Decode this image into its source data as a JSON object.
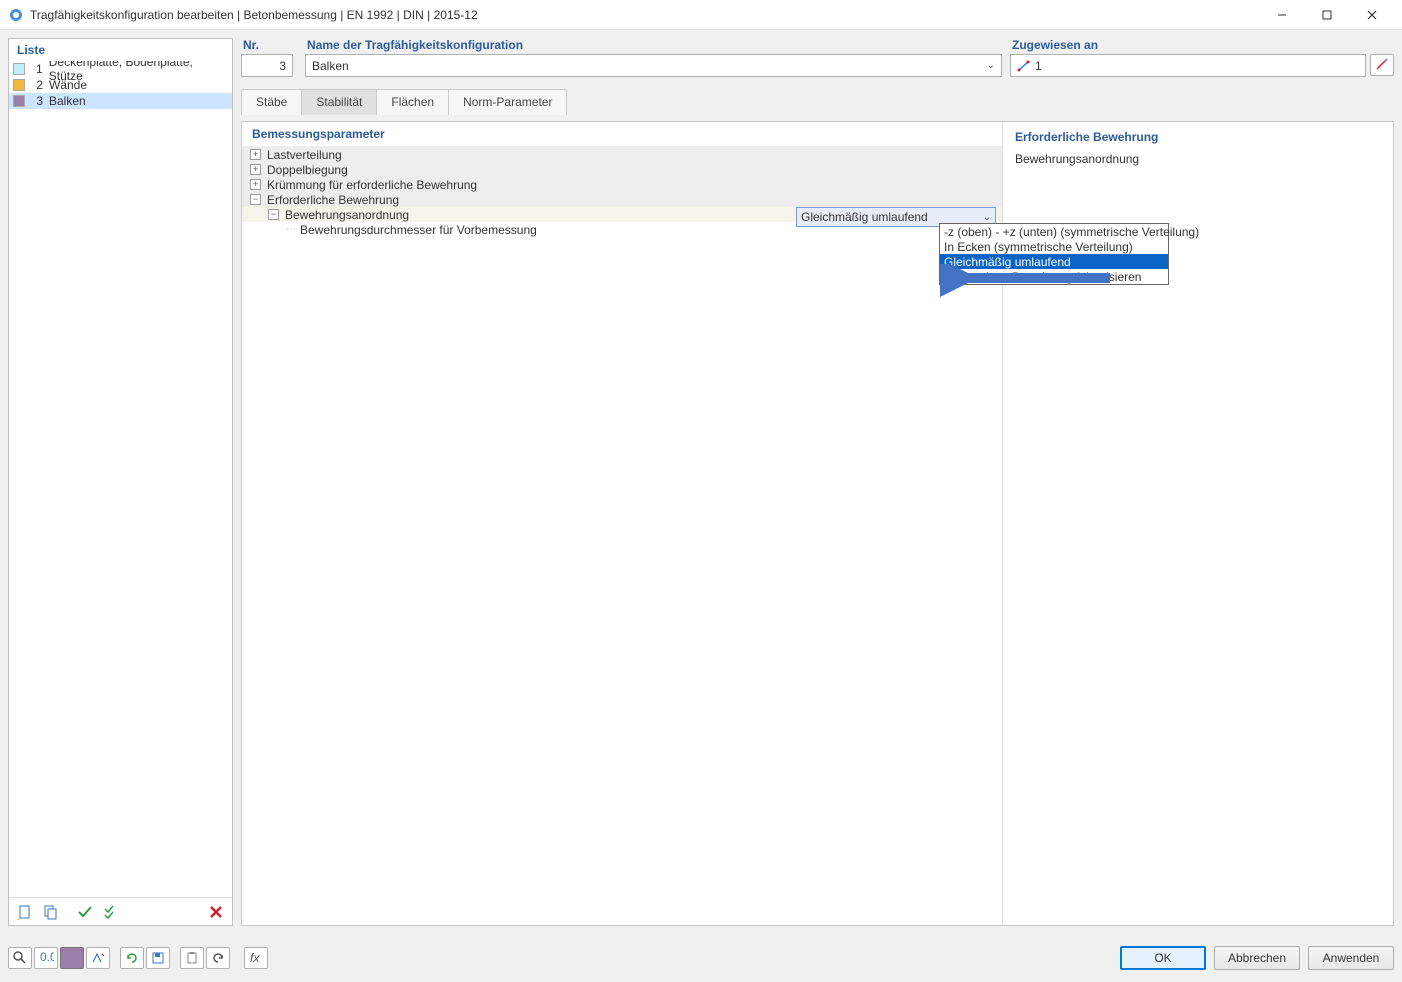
{
  "titlebar": {
    "title": "Tragfähigkeitskonfiguration bearbeiten | Betonbemessung | EN 1992 | DIN | 2015-12"
  },
  "leftPanel": {
    "header": "Liste",
    "items": [
      {
        "num": "1",
        "label": "Deckenplatte, Bodenplatte, Stütze",
        "color": "#bfeff2"
      },
      {
        "num": "2",
        "label": "Wände",
        "color": "#f2b63c"
      },
      {
        "num": "3",
        "label": "Balken",
        "color": "#9a7fa8"
      }
    ]
  },
  "fields": {
    "nr_label": "Nr.",
    "nr_value": "3",
    "name_label": "Name der Tragfähigkeitskonfiguration",
    "name_value": "Balken",
    "zugw_label": "Zugewiesen an",
    "zugw_value": "1"
  },
  "tabs": {
    "t0": "Stäbe",
    "t1": "Stabilität",
    "t2": "Flächen",
    "t3": "Norm-Parameter"
  },
  "params": {
    "header": "Bemessungsparameter",
    "r0": "Lastverteilung",
    "r1": "Doppelbiegung",
    "r2": "Krümmung für erforderliche Bewehrung",
    "r3": "Erforderliche Bewehrung",
    "r4": "Bewehrungsanordnung",
    "r5": "Bewehrungsdurchmesser für Vorbemessung"
  },
  "combo": {
    "value": "Gleichmäßig umlaufend"
  },
  "dropdown": {
    "o0": "-z (oben) - +z (unten) (symmetrische Verteilung)",
    "o1": "In Ecken (symmetrische Verteilung)",
    "o2": "Gleichmäßig umlaufend",
    "o3": "Vorhandene Bewehrung faktorisieren"
  },
  "info": {
    "title": "Erforderliche Bewehrung",
    "text": "Bewehrungsanordnung"
  },
  "buttons": {
    "ok": "OK",
    "cancel": "Abbrechen",
    "apply": "Anwenden"
  }
}
